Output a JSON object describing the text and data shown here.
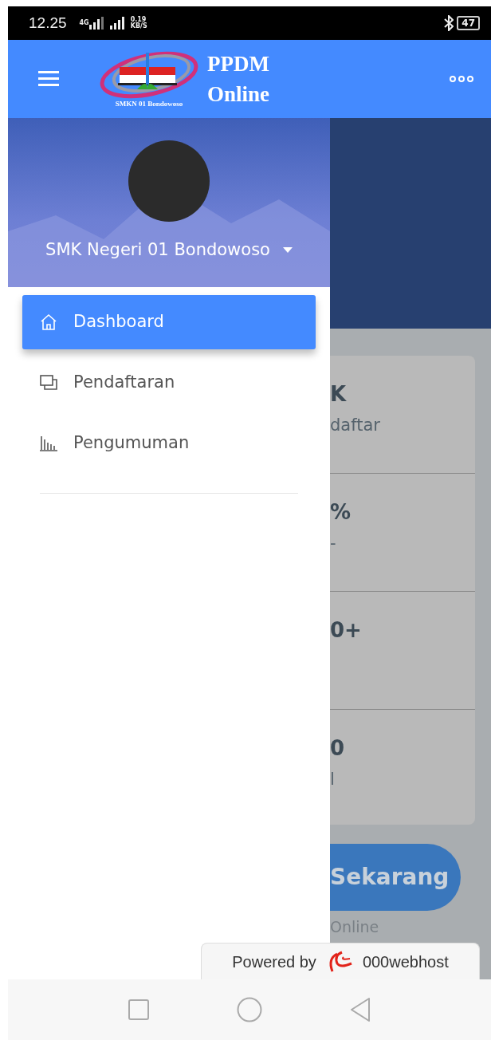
{
  "status_bar": {
    "time": "12.25",
    "network": "4G",
    "speed": "0.19",
    "speed_unit": "KB/S",
    "battery": "47"
  },
  "app_bar": {
    "logo_caption": "SMKN 01 Bondowoso",
    "title_lines": [
      "PPDM",
      "Online"
    ]
  },
  "drawer": {
    "profile_name": "SMK Negeri 01 Bondowoso",
    "items": [
      {
        "label": "Dashboard",
        "kind": "home",
        "selected": true
      },
      {
        "label": "Pendaftaran",
        "kind": "forms",
        "selected": false
      },
      {
        "label": "Pengumuman",
        "kind": "chart",
        "selected": false
      }
    ]
  },
  "background_card": {
    "sections": [
      {
        "value": "K",
        "caption": "daftar"
      },
      {
        "value": "%",
        "caption": "-"
      },
      {
        "value": "0+"
      },
      {
        "value": "0",
        "caption": "l"
      }
    ]
  },
  "background_button": {
    "label": "Sekarang"
  },
  "background_footer": {
    "text": "Online"
  },
  "hosting_badge": {
    "prefix": "Powered by",
    "brand": "000webhost"
  }
}
